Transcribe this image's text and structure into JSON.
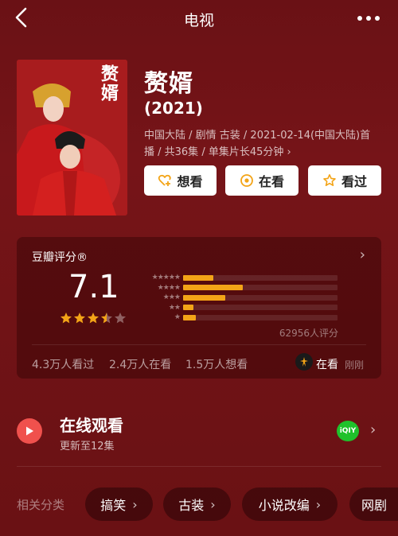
{
  "header": {
    "title": "电视"
  },
  "poster": {
    "title_art": "赘婿"
  },
  "show": {
    "title": "赘婿",
    "year": "(2021)",
    "meta": "中国大陆 / 剧情 古装 / 2021-02-14(中国大陆)首播 / 共36集 / 单集片长45分钟 ›"
  },
  "actions": {
    "want_label": "想看",
    "watching_label": "在看",
    "watched_label": "看过"
  },
  "rating": {
    "heading": "豆瓣评分®",
    "score": "7.1",
    "stars_value": 3.5,
    "distribution": [
      {
        "stars": 5,
        "percent": 19.8
      },
      {
        "stars": 4,
        "percent": 38.5
      },
      {
        "stars": 3,
        "percent": 27.3
      },
      {
        "stars": 2,
        "percent": 6.6
      },
      {
        "stars": 1,
        "percent": 8.4
      }
    ],
    "count_text": "62956人评分",
    "watched_text": "4.3万人看过",
    "watching_text": "2.4万人在看",
    "wish_text": "1.5万人想看",
    "my_status": "在看",
    "my_status_time": "刚刚"
  },
  "online": {
    "title": "在线观看",
    "subtitle": "更新至12集",
    "platform_logo": "iQIY"
  },
  "tags": {
    "label": "相关分类",
    "items": [
      "搞笑",
      "古装",
      "小说改编",
      "网剧"
    ]
  },
  "colors": {
    "background": "#6e1216",
    "accent": "#f3a417",
    "play": "#f0514d",
    "iqiyi": "#1fc12b"
  }
}
